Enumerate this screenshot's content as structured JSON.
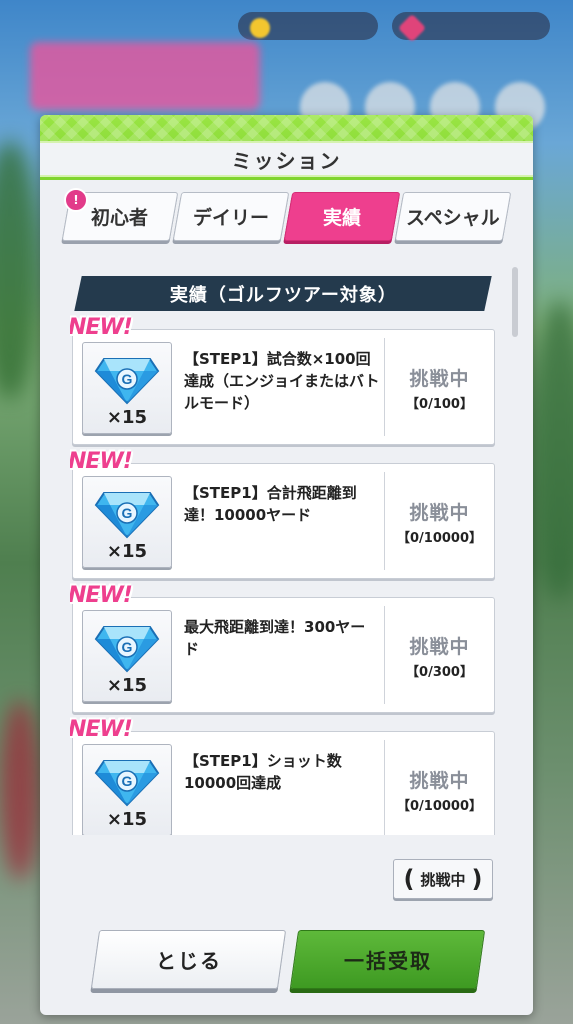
{
  "dialog": {
    "title": "ミッション"
  },
  "tabs": [
    {
      "label": "初心者",
      "active": false,
      "badge": "!"
    },
    {
      "label": "デイリー",
      "active": false
    },
    {
      "label": "実績",
      "active": true
    },
    {
      "label": "スペシャル",
      "active": false
    }
  ],
  "section": {
    "title": "実績（ゴルフツアー対象）"
  },
  "missions": [
    {
      "new_label": "NEW!",
      "reward_icon": "blue-gem-g-icon",
      "reward_qty": "×15",
      "description": "【STEP1】試合数×100回達成（エンジョイまたはバトルモード）",
      "status": "挑戦中",
      "progress": "【0/100】"
    },
    {
      "new_label": "NEW!",
      "reward_icon": "blue-gem-g-icon",
      "reward_qty": "×15",
      "description": "【STEP1】合計飛距離到達！10000ヤード",
      "status": "挑戦中",
      "progress": "【0/10000】"
    },
    {
      "new_label": "NEW!",
      "reward_icon": "blue-gem-g-icon",
      "reward_qty": "×15",
      "description": "最大飛距離到達！300ヤード",
      "status": "挑戦中",
      "progress": "【0/300】"
    },
    {
      "new_label": "NEW!",
      "reward_icon": "blue-gem-g-icon",
      "reward_qty": "×15",
      "description": "【STEP1】ショット数10000回達成",
      "status": "挑戦中",
      "progress": "【0/10000】"
    }
  ],
  "filter": {
    "label": "挑戦中"
  },
  "buttons": {
    "close": "とじる",
    "claim_all": "一括受取"
  },
  "colors": {
    "header_green": "#8cdd3a",
    "active_tab_pink": "#ee3f8e",
    "section_navy": "#243a4d",
    "claim_green": "#4ea92e"
  }
}
